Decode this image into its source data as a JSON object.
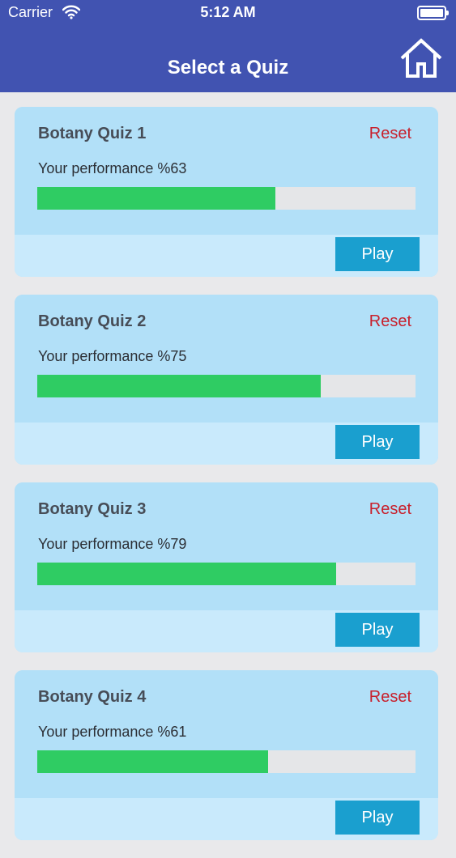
{
  "status": {
    "carrier": "Carrier",
    "time": "5:12 AM"
  },
  "header": {
    "title": "Select a Quiz",
    "home_icon": "home-icon"
  },
  "colors": {
    "header": "#4153b1",
    "progress": "#2fcc63",
    "reset": "#c8202c",
    "play": "#1a9fcf",
    "card": "#b2e0f8"
  },
  "quizzes": [
    {
      "name": "Botany Quiz 1",
      "reset_label": "Reset",
      "performance": "Your performance %63",
      "percent": 63,
      "play_label": "Play"
    },
    {
      "name": "Botany Quiz 2",
      "reset_label": "Reset",
      "performance": "Your performance %75",
      "percent": 75,
      "play_label": "Play"
    },
    {
      "name": "Botany Quiz 3",
      "reset_label": "Reset",
      "performance": "Your performance %79",
      "percent": 79,
      "play_label": "Play"
    },
    {
      "name": "Botany Quiz 4",
      "reset_label": "Reset",
      "performance": "Your performance %61",
      "percent": 61,
      "play_label": "Play"
    }
  ]
}
